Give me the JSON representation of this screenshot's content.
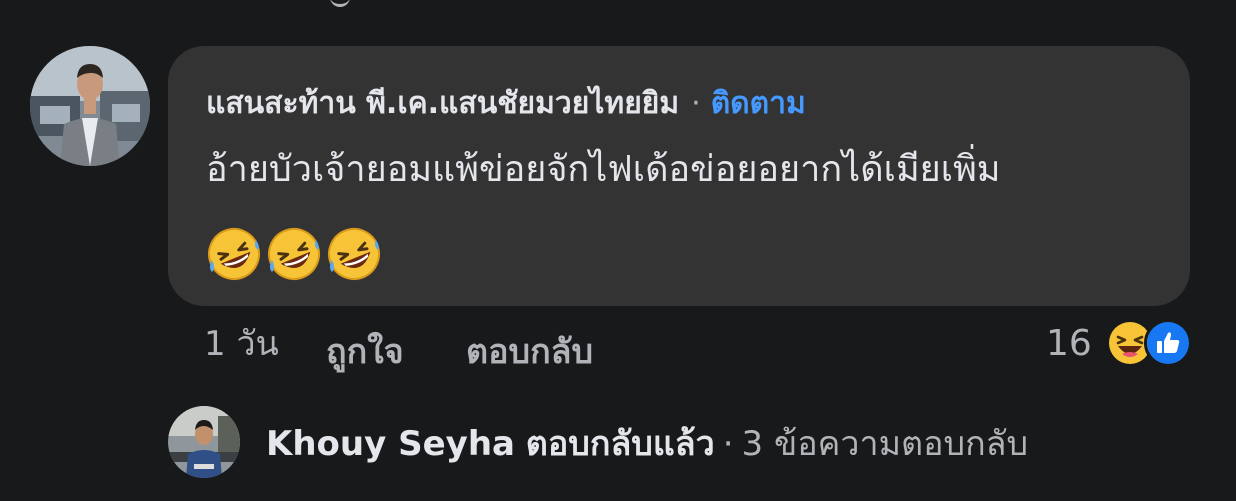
{
  "comment": {
    "author": "แสนสะท้าน พี.เค.แสนชัยมวยไทยยิม",
    "separator": "·",
    "follow_label": "ติดตาม",
    "text": "อ้ายบัวเจ้ายอมแพ้ข่อยจักไฟเด้อข่อยอยากได้เมียเพิ่ม",
    "emojis": [
      "rofl-emoji",
      "rofl-emoji",
      "rofl-emoji"
    ]
  },
  "actions": {
    "time": "1 วัน",
    "like_label": "ถูกใจ",
    "reply_label": "ตอบกลับ"
  },
  "reactions": {
    "count": "16",
    "icons": [
      "haha-icon",
      "like-icon"
    ]
  },
  "reply_summary": {
    "author": "Khouy Seyha",
    "verb": "ตอบกลับแล้ว",
    "separator": "·",
    "count_text": "3 ข้อความตอบกลับ"
  },
  "colors": {
    "background": "#18191a",
    "bubble": "#333334",
    "link": "#4599ff",
    "secondary_text": "#b0b3b8"
  }
}
